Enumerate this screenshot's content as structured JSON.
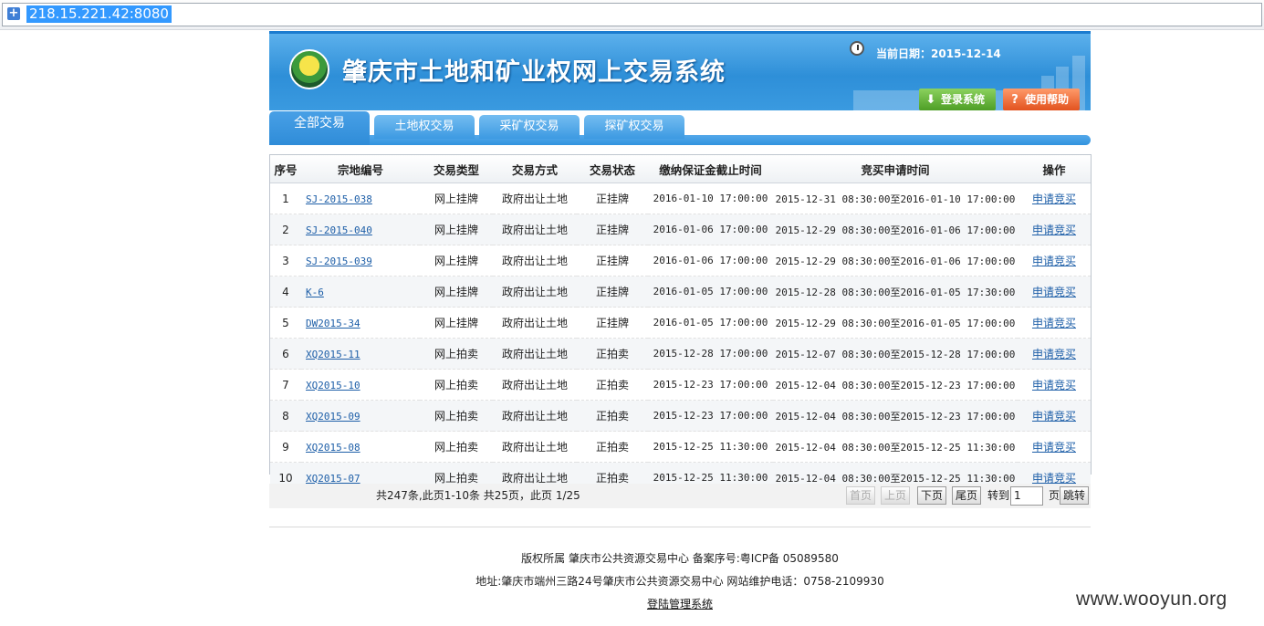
{
  "browser": {
    "url": "218.15.221.42:8080"
  },
  "header": {
    "title": "肇庆市土地和矿业权网上交易系统",
    "date_label": "当前日期：",
    "date_value": "2015-12-14",
    "login_label": "登录系统",
    "help_label": "使用帮助"
  },
  "tabs": [
    {
      "label": "全部交易",
      "active": true
    },
    {
      "label": "土地权交易"
    },
    {
      "label": "采矿权交易"
    },
    {
      "label": "探矿权交易"
    }
  ],
  "table": {
    "columns": [
      "序号",
      "宗地编号",
      "交易类型",
      "交易方式",
      "交易状态",
      "缴纳保证金截止时间",
      "竞买申请时间",
      "操作"
    ],
    "rows": [
      {
        "no": "1",
        "code": "SJ-2015-038",
        "type": "网上挂牌",
        "method": "政府出让土地",
        "status": "正挂牌",
        "deadline": "2016-01-10 17:00:00",
        "apply_time": "2015-12-31 08:30:00至2016-01-10 17:00:00",
        "action": "申请竞买"
      },
      {
        "no": "2",
        "code": "SJ-2015-040",
        "type": "网上挂牌",
        "method": "政府出让土地",
        "status": "正挂牌",
        "deadline": "2016-01-06 17:00:00",
        "apply_time": "2015-12-29 08:30:00至2016-01-06 17:00:00",
        "action": "申请竞买"
      },
      {
        "no": "3",
        "code": "SJ-2015-039",
        "type": "网上挂牌",
        "method": "政府出让土地",
        "status": "正挂牌",
        "deadline": "2016-01-06 17:00:00",
        "apply_time": "2015-12-29 08:30:00至2016-01-06 17:00:00",
        "action": "申请竞买"
      },
      {
        "no": "4",
        "code": "K-6",
        "type": "网上挂牌",
        "method": "政府出让土地",
        "status": "正挂牌",
        "deadline": "2016-01-05 17:00:00",
        "apply_time": "2015-12-28 08:30:00至2016-01-05 17:30:00",
        "action": "申请竞买"
      },
      {
        "no": "5",
        "code": "DW2015-34",
        "type": "网上挂牌",
        "method": "政府出让土地",
        "status": "正挂牌",
        "deadline": "2016-01-05 17:00:00",
        "apply_time": "2015-12-29 08:30:00至2016-01-05 17:00:00",
        "action": "申请竞买"
      },
      {
        "no": "6",
        "code": "XQ2015-11",
        "type": "网上拍卖",
        "method": "政府出让土地",
        "status": "正拍卖",
        "deadline": "2015-12-28 17:00:00",
        "apply_time": "2015-12-07 08:30:00至2015-12-28 17:00:00",
        "action": "申请竞买"
      },
      {
        "no": "7",
        "code": "XQ2015-10",
        "type": "网上拍卖",
        "method": "政府出让土地",
        "status": "正拍卖",
        "deadline": "2015-12-23 17:00:00",
        "apply_time": "2015-12-04 08:30:00至2015-12-23 17:00:00",
        "action": "申请竞买"
      },
      {
        "no": "8",
        "code": "XQ2015-09",
        "type": "网上拍卖",
        "method": "政府出让土地",
        "status": "正拍卖",
        "deadline": "2015-12-23 17:00:00",
        "apply_time": "2015-12-04 08:30:00至2015-12-23 17:00:00",
        "action": "申请竞买"
      },
      {
        "no": "9",
        "code": "XQ2015-08",
        "type": "网上拍卖",
        "method": "政府出让土地",
        "status": "正拍卖",
        "deadline": "2015-12-25 11:30:00",
        "apply_time": "2015-12-04 08:30:00至2015-12-25 11:30:00",
        "action": "申请竞买"
      },
      {
        "no": "10",
        "code": "XQ2015-07",
        "type": "网上拍卖",
        "method": "政府出让土地",
        "status": "正拍卖",
        "deadline": "2015-12-25 11:30:00",
        "apply_time": "2015-12-04 08:30:00至2015-12-25 11:30:00",
        "action": "申请竞买"
      }
    ]
  },
  "pager": {
    "info": "共247条,此页1-10条  共25页，此页 1/25",
    "first": "首页",
    "prev": "上页",
    "next": "下页",
    "last": "尾页",
    "goto": "转到",
    "page_value": "1",
    "page_unit": "页",
    "jump": "跳转"
  },
  "footer": {
    "line1": "版权所属 肇庆市公共资源交易中心 备案序号:粤ICP备 05089580",
    "line2": "地址:肇庆市端州三路24号肇庆市公共资源交易中心   网站维护电话：0758-2109930",
    "admin_link": "登陆管理系统"
  },
  "watermark": "www.wooyun.org"
}
